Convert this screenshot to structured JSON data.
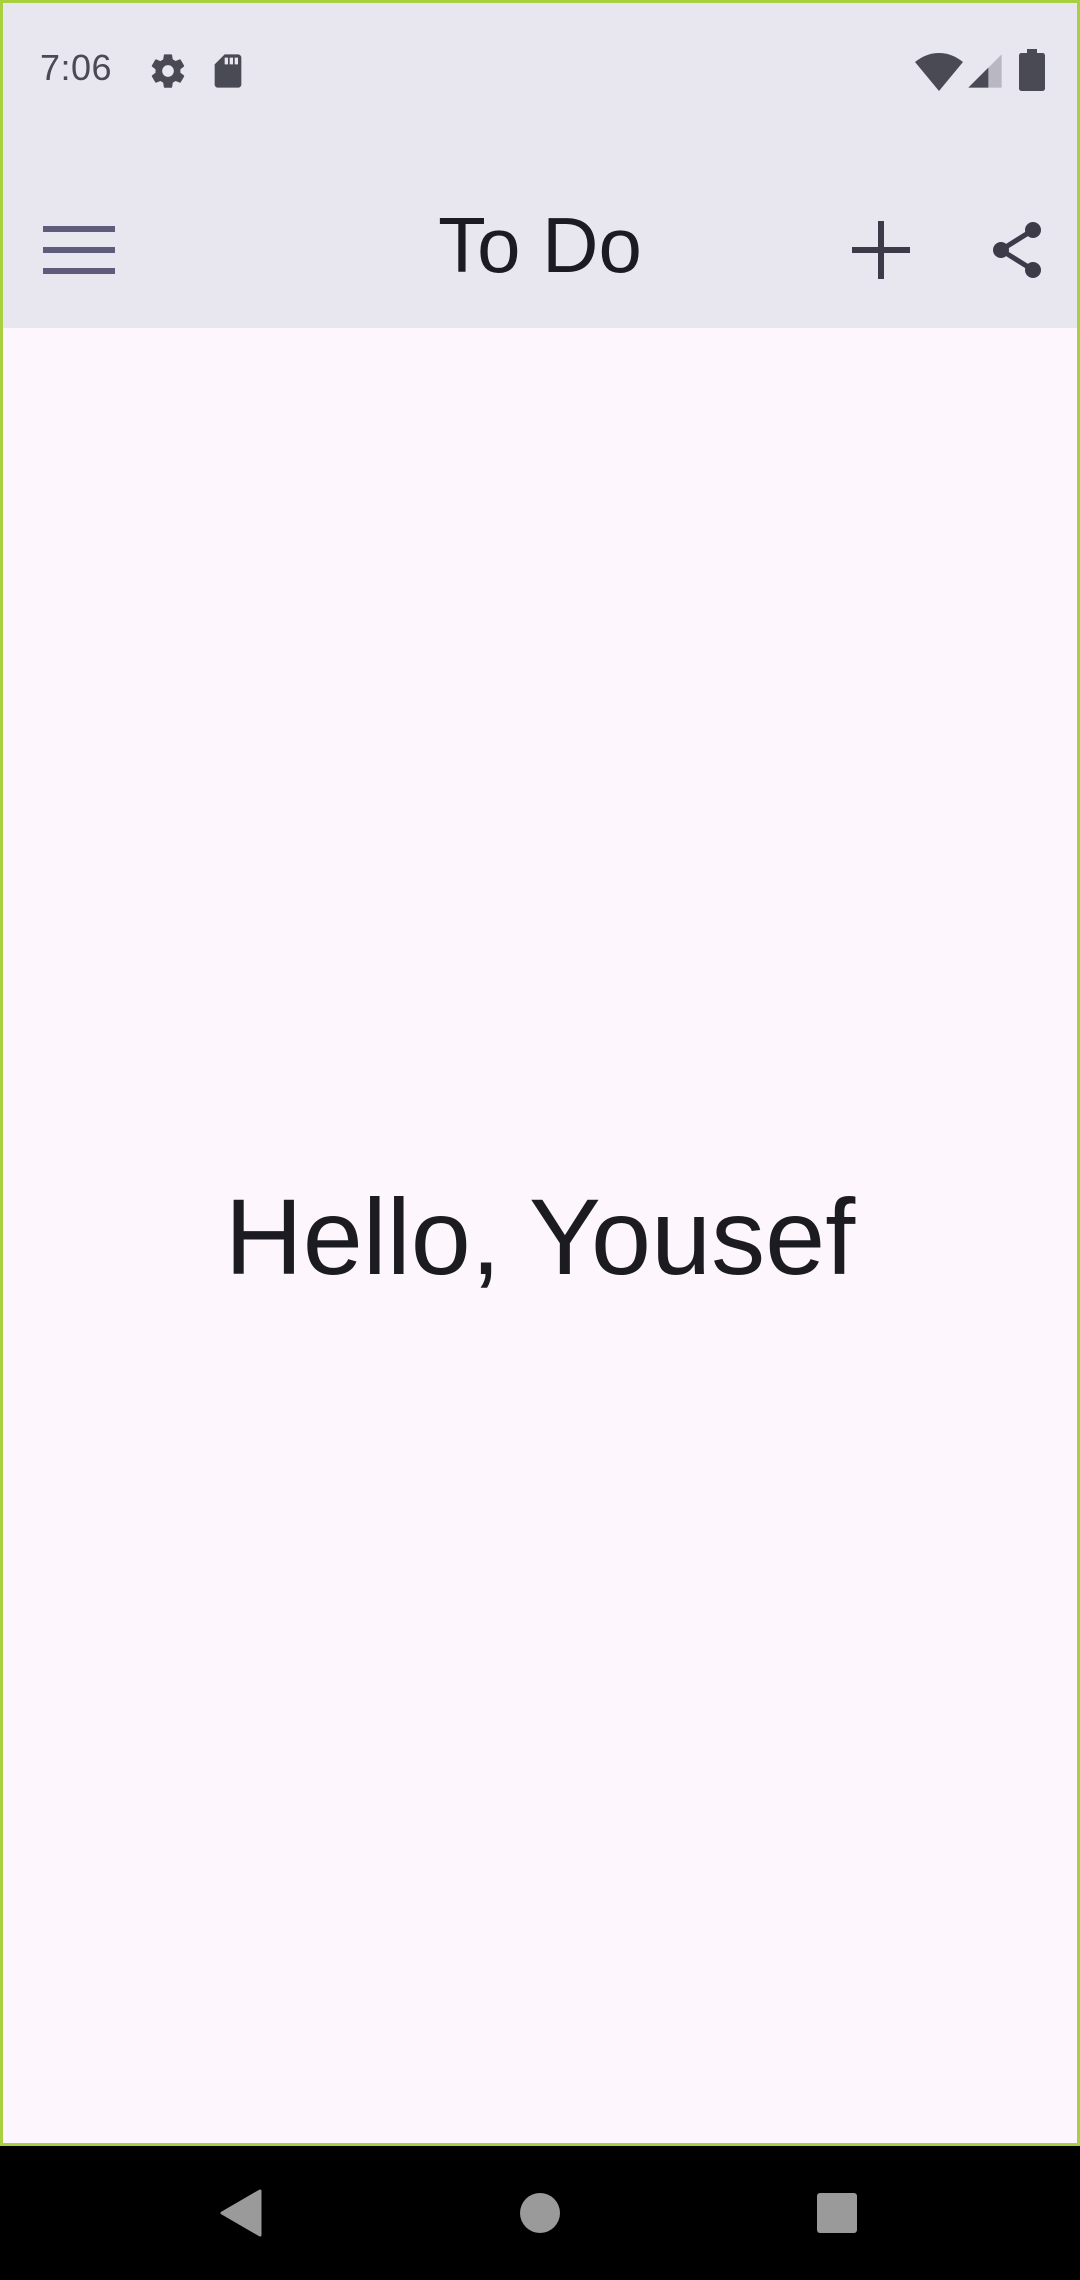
{
  "status_bar": {
    "time": "7:06",
    "left_icons": [
      "gear-icon",
      "sd-card-icon"
    ],
    "right_icons": [
      "wifi-icon",
      "cell-signal-icon",
      "battery-icon"
    ]
  },
  "app_bar": {
    "title": "To Do",
    "menu_icon": "menu-icon",
    "add_icon": "add-icon",
    "share_icon": "share-icon"
  },
  "main": {
    "greeting": "Hello, Yousef"
  },
  "nav_bar": {
    "buttons": [
      "back-icon",
      "home-icon",
      "recents-icon"
    ]
  },
  "colors": {
    "bar_background": "#e8e6ef",
    "content_background": "#fdf7fd",
    "icon_color": "#5f5b7a",
    "text_color": "#1c1b22",
    "frame_border": "#a9d13f"
  }
}
